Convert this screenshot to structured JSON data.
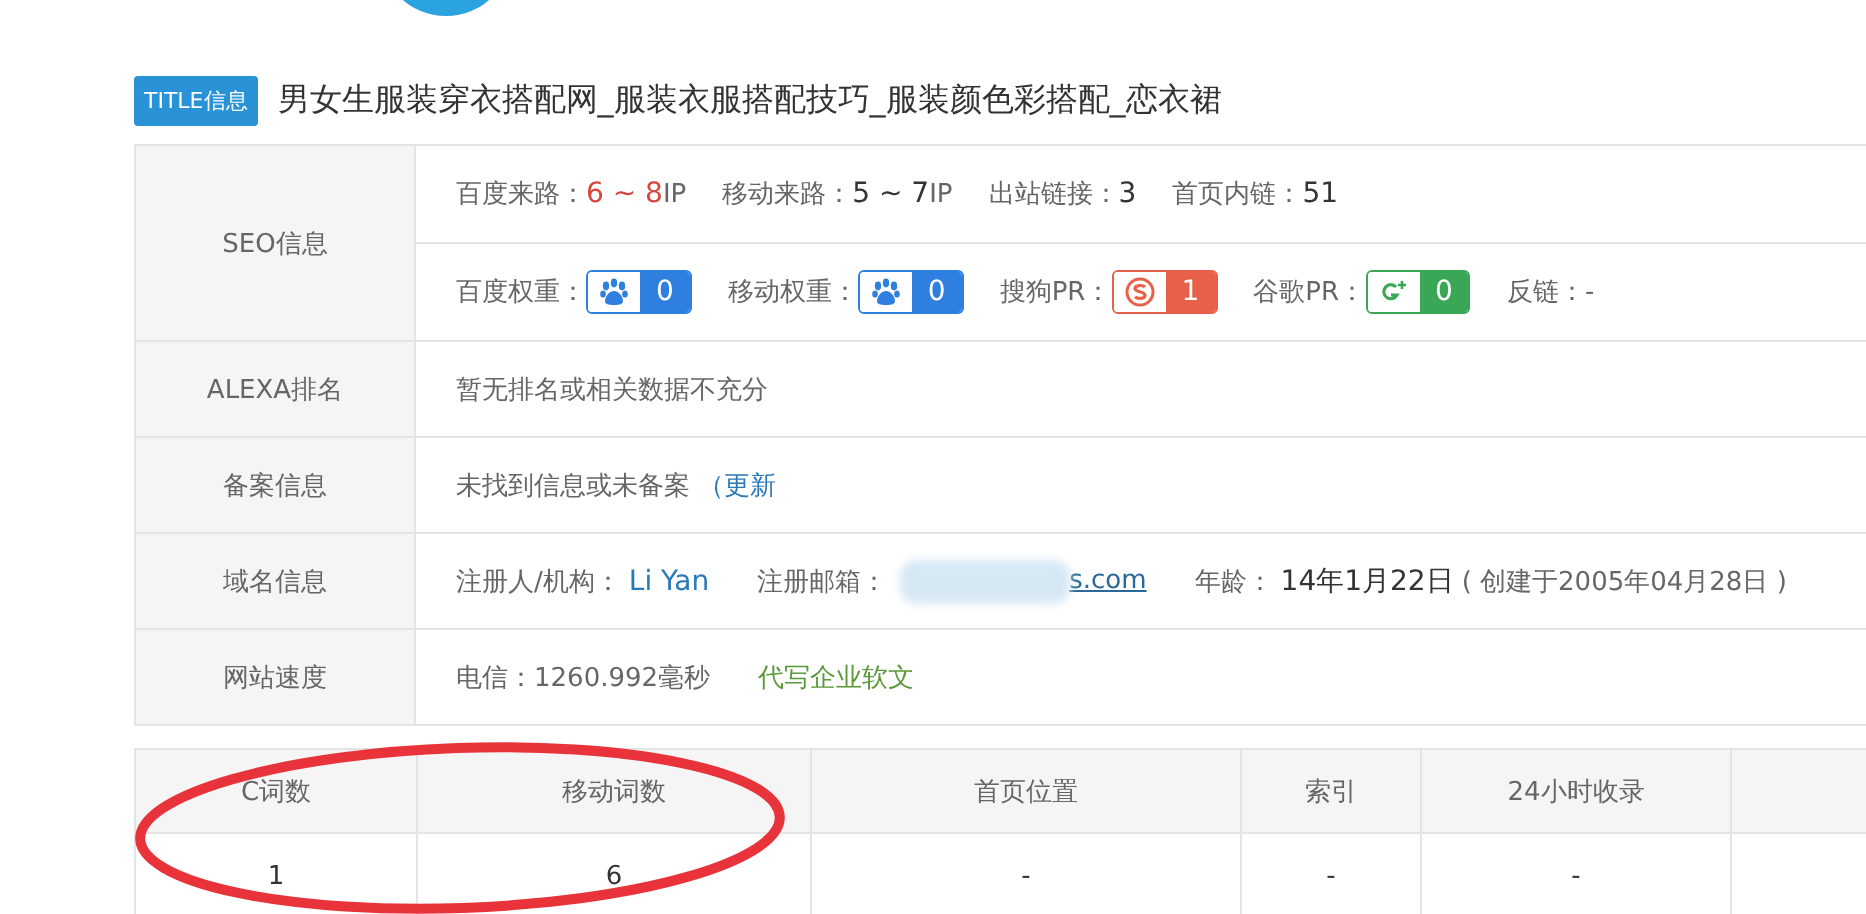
{
  "title_badge": "TITLE信息",
  "title": "男女生服装穿衣搭配网_服装衣服搭配技巧_服装颜色彩搭配_恋衣裙",
  "seo": {
    "label": "SEO信息",
    "stats": [
      {
        "label": "百度来路：",
        "value": "6 ~ 8",
        "unit": "IP",
        "highlight": true
      },
      {
        "label": "移动来路：",
        "value": "5 ~ 7",
        "unit": "IP",
        "highlight": false
      },
      {
        "label": "出站链接：",
        "value": "3",
        "highlight": false
      },
      {
        "label": "首页内链：",
        "value": "51",
        "highlight": false
      }
    ],
    "ranks": [
      {
        "label": "百度权重：",
        "kind": "baidu",
        "value": "0"
      },
      {
        "label": "移动权重：",
        "kind": "mobile",
        "value": "0"
      },
      {
        "label": "搜狗PR：",
        "kind": "sogou",
        "value": "1"
      },
      {
        "label": "谷歌PR：",
        "kind": "google",
        "value": "0"
      },
      {
        "label": "反链：-",
        "kind": "text"
      }
    ]
  },
  "alexa": {
    "label": "ALEXA排名",
    "value": "暂无排名或相关数据不充分"
  },
  "icp": {
    "label": "备案信息",
    "value": "未找到信息或未备案",
    "link": "（更新"
  },
  "domain": {
    "label": "域名信息",
    "registrant_label": "注册人/机构：",
    "registrant": "Li Yan",
    "email_label": "注册邮箱：",
    "email": "s.com",
    "age_label": "年龄：",
    "age": "14年1月22日",
    "created": "( 创建于2005年04月28日 )"
  },
  "speed": {
    "label": "网站速度",
    "value": "电信：1260.992毫秒",
    "link": "代写企业软文"
  },
  "table": {
    "columns": [
      "C词数",
      "移动词数",
      "首页位置",
      "索引",
      "24小时收录"
    ],
    "rows": [
      [
        "1",
        "6",
        "-",
        "-",
        "-"
      ]
    ]
  }
}
